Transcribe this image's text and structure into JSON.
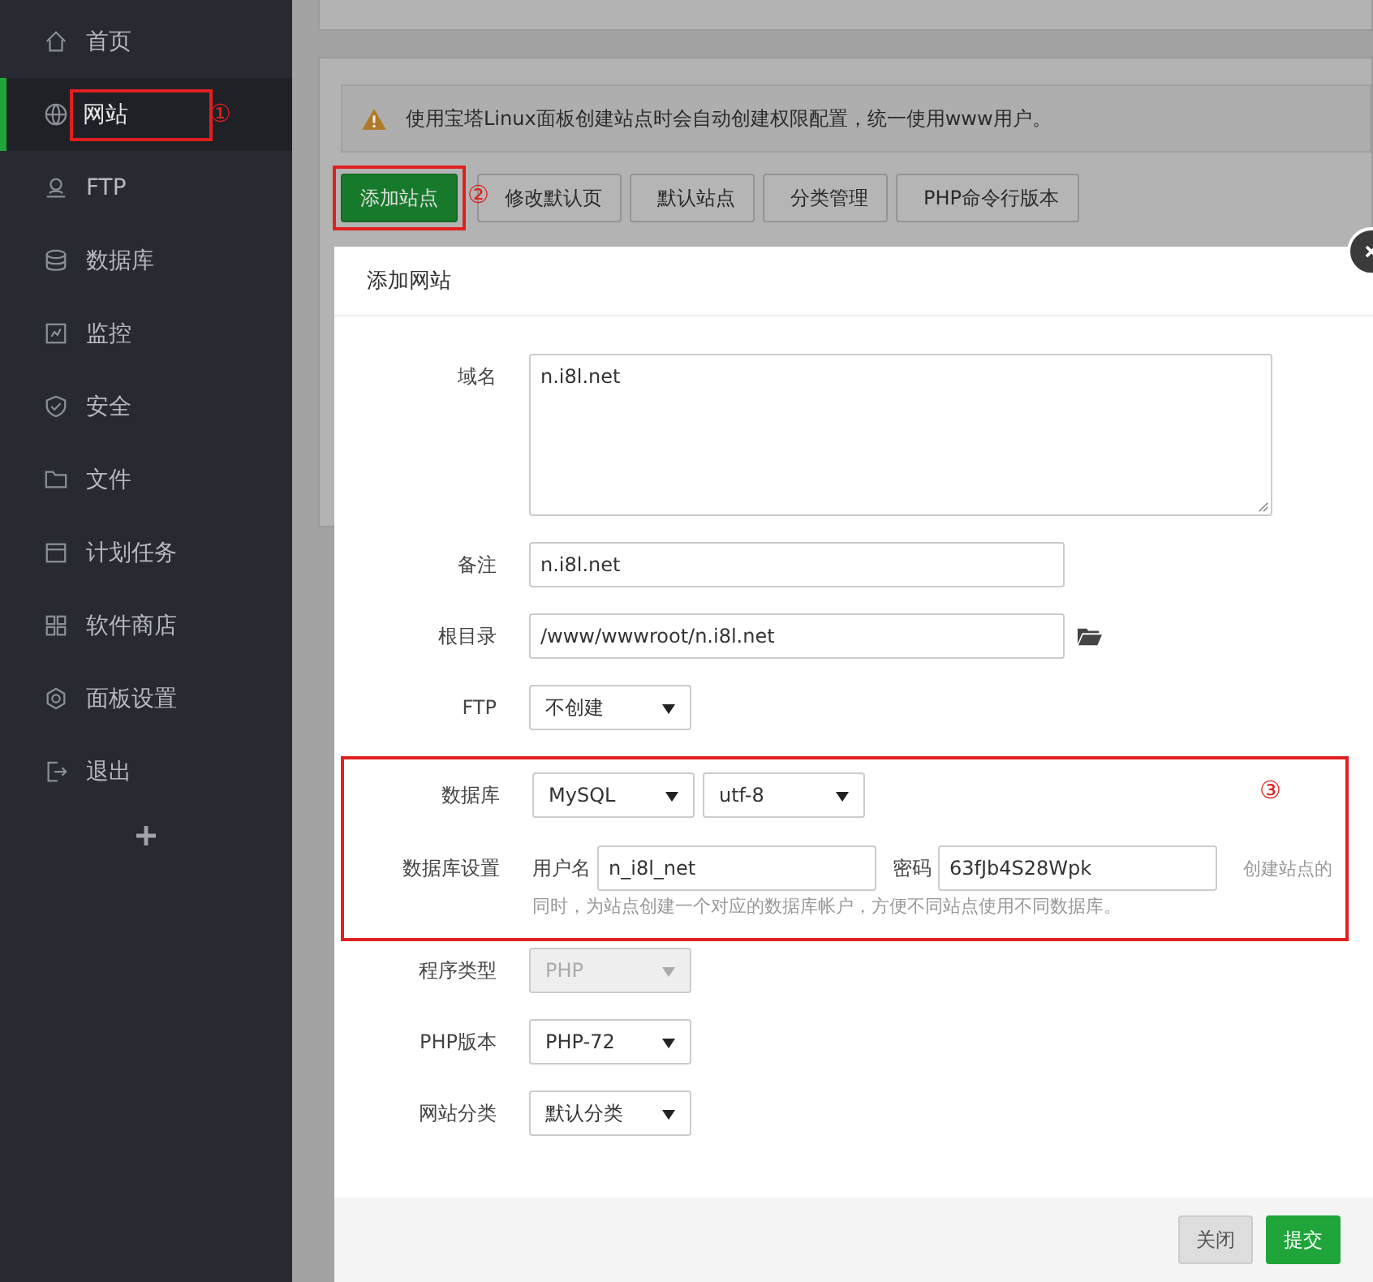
{
  "sidebar": {
    "items": [
      {
        "label": "首页",
        "selected": false
      },
      {
        "label": "网站",
        "selected": true
      },
      {
        "label": "FTP",
        "selected": false
      },
      {
        "label": "数据库",
        "selected": false
      },
      {
        "label": "监控",
        "selected": false
      },
      {
        "label": "安全",
        "selected": false
      },
      {
        "label": "文件",
        "selected": false
      },
      {
        "label": "计划任务",
        "selected": false
      },
      {
        "label": "软件商店",
        "selected": false
      },
      {
        "label": "面板设置",
        "selected": false
      },
      {
        "label": "退出",
        "selected": false
      }
    ],
    "annotation": "①"
  },
  "notice": {
    "text": "使用宝塔Linux面板创建站点时会自动创建权限配置，统一使用www用户。"
  },
  "toolbar": {
    "annotation": "②",
    "buttons": [
      {
        "label": "添加站点",
        "kind": "primary",
        "highlighted": true
      },
      {
        "label": "修改默认页",
        "kind": "default",
        "highlighted": false
      },
      {
        "label": "默认站点",
        "kind": "default",
        "highlighted": false
      },
      {
        "label": "分类管理",
        "kind": "default",
        "highlighted": false
      },
      {
        "label": "PHP命令行版本",
        "kind": "default",
        "highlighted": false
      }
    ]
  },
  "dialog": {
    "title": "添加网站",
    "fields": [
      {
        "kind": "textarea",
        "label": "域名",
        "value": "n.i8l.net"
      },
      {
        "kind": "input",
        "label": "备注",
        "value": "n.i8l.net"
      },
      {
        "kind": "path",
        "label": "根目录",
        "value": "/www/wwwroot/n.i8l.net"
      },
      {
        "kind": "select",
        "label": "FTP",
        "value": "不创建",
        "disabled": false
      }
    ],
    "database": {
      "annotation": "③",
      "type_label": "数据库",
      "type": "MySQL",
      "charset": "utf-8",
      "settings_label": "数据库设置",
      "user_label": "用户名",
      "user": "n_i8l_net",
      "password_label": "密码",
      "password": "63fJb4S28Wpk",
      "help_start": "创建站点的",
      "help_rest": "同时，为站点创建一个对应的数据库帐户，方便不同站点使用不同数据库。"
    },
    "more_fields": [
      {
        "label": "程序类型",
        "value": "PHP",
        "disabled": true
      },
      {
        "label": "PHP版本",
        "value": "PHP-72",
        "disabled": false
      },
      {
        "label": "网站分类",
        "value": "默认分类",
        "disabled": false
      }
    ],
    "buttons": [
      {
        "label": "关闭",
        "kind": "secondary"
      },
      {
        "label": "提交",
        "kind": "primary"
      }
    ]
  }
}
